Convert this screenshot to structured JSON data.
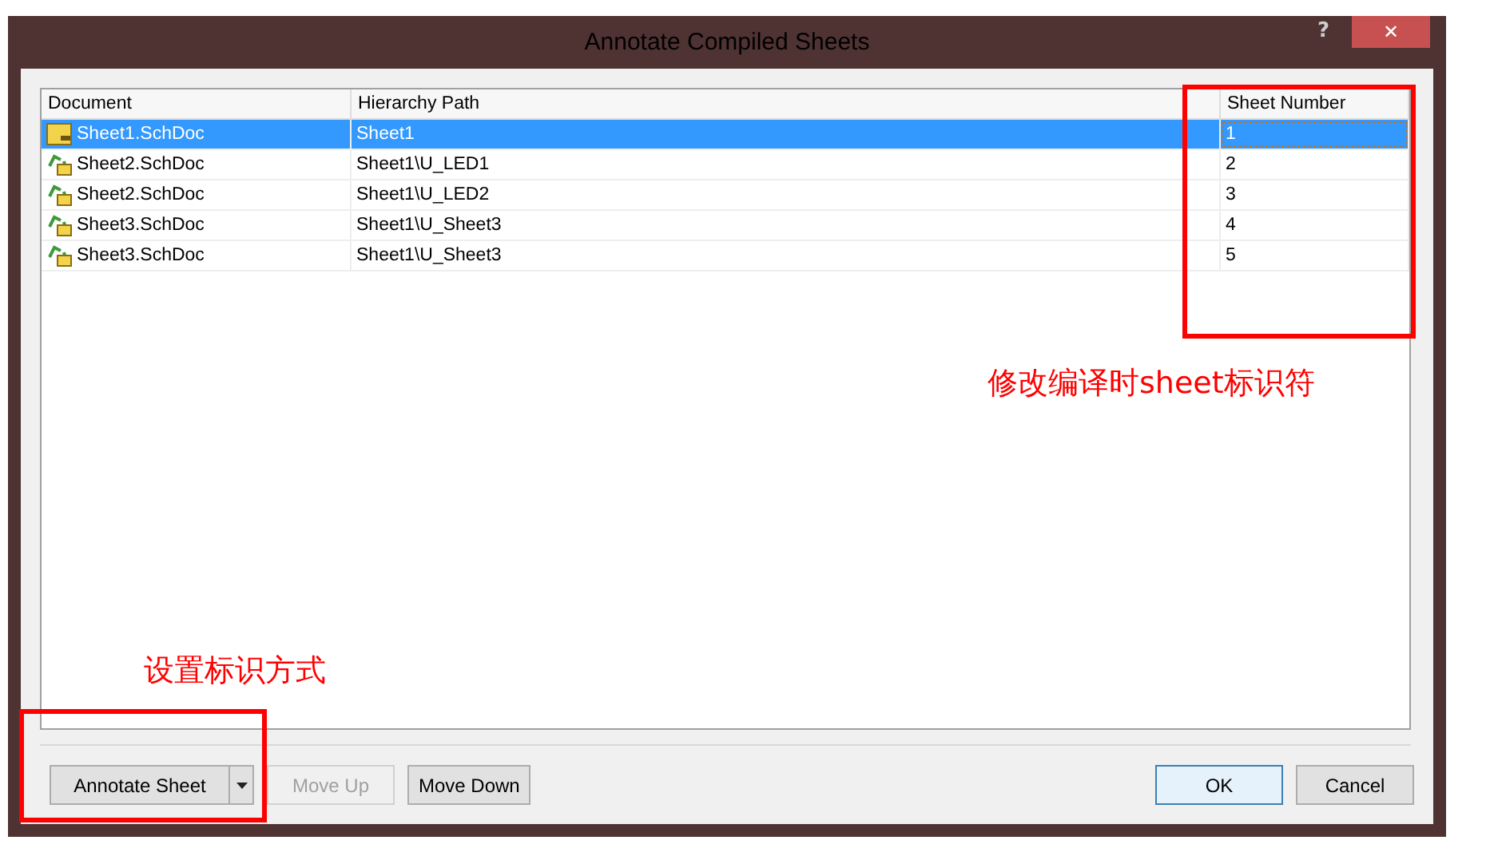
{
  "window": {
    "title": "Annotate Compiled Sheets",
    "help": "?",
    "close": "✕"
  },
  "table": {
    "columns": [
      "Document",
      "Hierarchy Path",
      "Sheet Number"
    ],
    "rows": [
      {
        "kind": "top",
        "document": "Sheet1.SchDoc",
        "path": "Sheet1",
        "number": "1",
        "selected": true
      },
      {
        "kind": "child",
        "document": "Sheet2.SchDoc",
        "path": "Sheet1\\U_LED1",
        "number": "2",
        "selected": false
      },
      {
        "kind": "child",
        "document": "Sheet2.SchDoc",
        "path": "Sheet1\\U_LED2",
        "number": "3",
        "selected": false
      },
      {
        "kind": "child",
        "document": "Sheet3.SchDoc",
        "path": "Sheet1\\U_Sheet3",
        "number": "4",
        "selected": false
      },
      {
        "kind": "child",
        "document": "Sheet3.SchDoc",
        "path": "Sheet1\\U_Sheet3",
        "number": "5",
        "selected": false
      }
    ]
  },
  "buttons": {
    "annotate": {
      "label": "Annotate Sheet",
      "disabled": false
    },
    "move_up": {
      "label": "Move Up",
      "disabled": true
    },
    "move_down": {
      "label": "Move Down",
      "disabled": false
    },
    "ok": {
      "label": "OK",
      "disabled": false
    },
    "cancel": {
      "label": "Cancel",
      "disabled": false
    }
  },
  "annotations": [
    {
      "text": "修改编译时sheet标识符"
    },
    {
      "text": "设置标识方式"
    }
  ]
}
